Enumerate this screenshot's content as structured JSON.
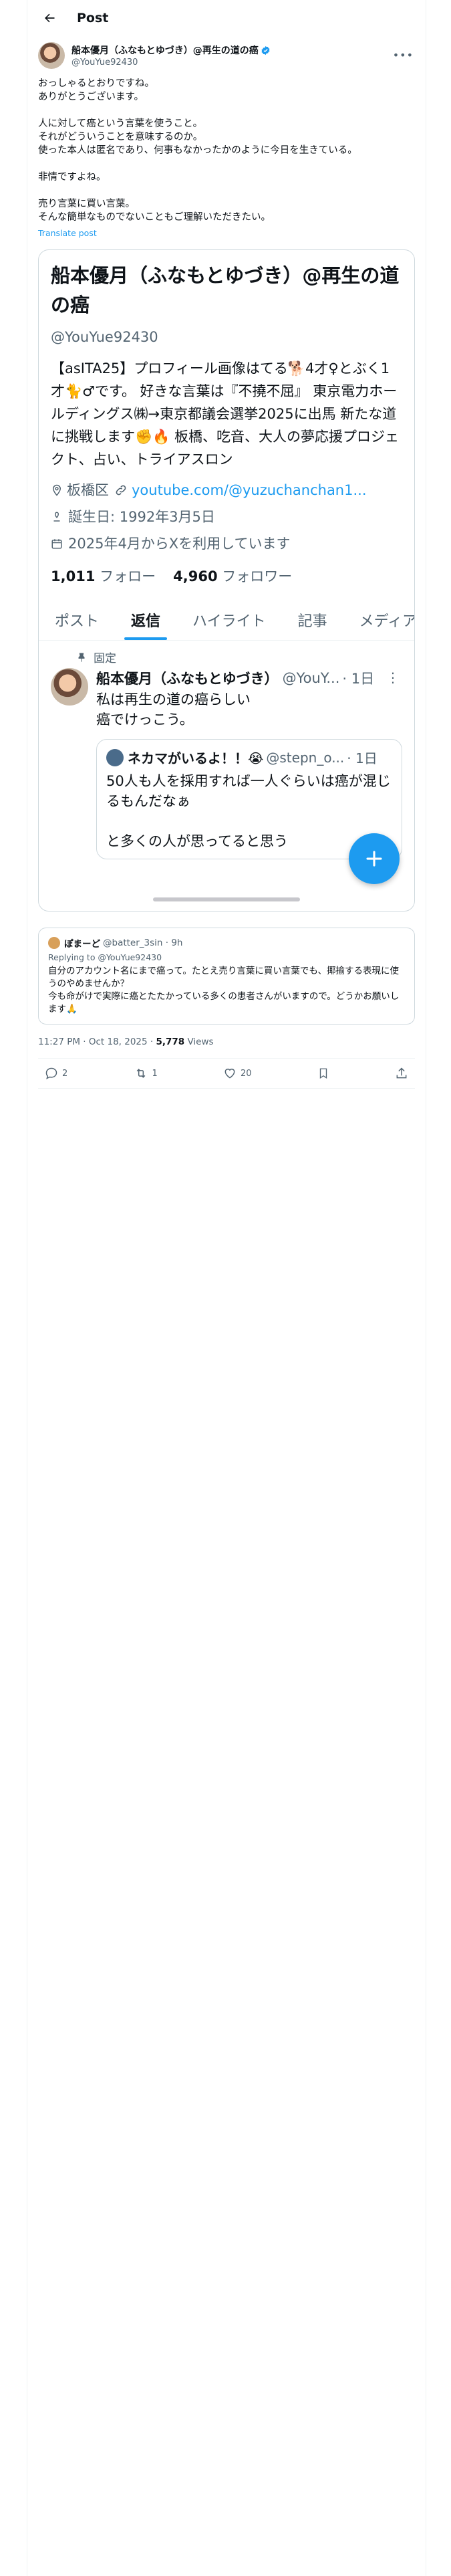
{
  "topbar": {
    "title": "Post"
  },
  "author": {
    "name": "船本優月（ふなもとゆづき）@再生の道の癌",
    "handle": "@YouYue92430"
  },
  "tweet": {
    "paragraphs": [
      "おっしゃるとおりですね。\nありがとうございます。",
      "人に対して癌という言葉を使うこと。\nそれがどういうことを意味するのか。\n使った本人は匿名であり、何事もなかったかのように今日を生きている。",
      "非情ですよね。",
      "売り言葉に買い言葉。\nそんな簡単なものでないこともご理解いただきたい。"
    ],
    "translate": "Translate post"
  },
  "profile_card": {
    "name": "船本優月（ふなもとゆづき）@再生の道の癌",
    "handle": "@YouYue92430",
    "bio": "【asITA25】プロフィール画像はてる🐕4才♀とぶく1才🐈♂です。 好きな言葉は『不撓不屈』 東京電力ホールディングス㈱→東京都議会選挙2025に出馬 新たな道に挑戦します✊🔥 板橋、吃音、大人の夢応援プロジェクト、占い、トライアスロン",
    "location": "板橋区",
    "link": "youtube.com/@yuzuchanchan1...",
    "birthday": "誕生日: 1992年3月5日",
    "joined": "2025年4月からXを利用しています",
    "following_count": "1,011",
    "following_label": "フォロー",
    "followers_count": "4,960",
    "followers_label": "フォロワー",
    "tabs": [
      "ポスト",
      "返信",
      "ハイライト",
      "記事",
      "メディア"
    ],
    "active_tab": 1,
    "pinned_label": "固定",
    "pinned_reply": {
      "name": "船本優月（ふなもとゆづき）",
      "handle": "@YouY...",
      "date": "· 1日",
      "text": "私は再生の道の癌らしい\n癌でけっこう。"
    },
    "quoted": {
      "name": "ネカマがいるよ！！😭",
      "handle": "@stepn_o...",
      "date": "· 1日",
      "text": "50人も人を採用すれば一人ぐらいは癌が混じるもんだなぁ\n\nと多くの人が思ってると思う"
    }
  },
  "quoted_reply": {
    "name": "ぽまーど",
    "handle": "@batter_3sin · 9h",
    "replying": "Replying to @YouYue92430",
    "text": "自分のアカウント名にまで癌って。たとえ売り言葉に買い言葉でも、揶揄する表現に使うのやめませんか？\n今も命がけで実際に癌とたたかっている多くの患者さんがいますので。どうかお願いします🙏"
  },
  "timestamp": {
    "time": "11:27 PM · Oct 18, 2025 · ",
    "views_count": "5,778",
    "views_label": " Views"
  },
  "actions": {
    "replies": "2",
    "reposts": "1",
    "likes": "20"
  }
}
